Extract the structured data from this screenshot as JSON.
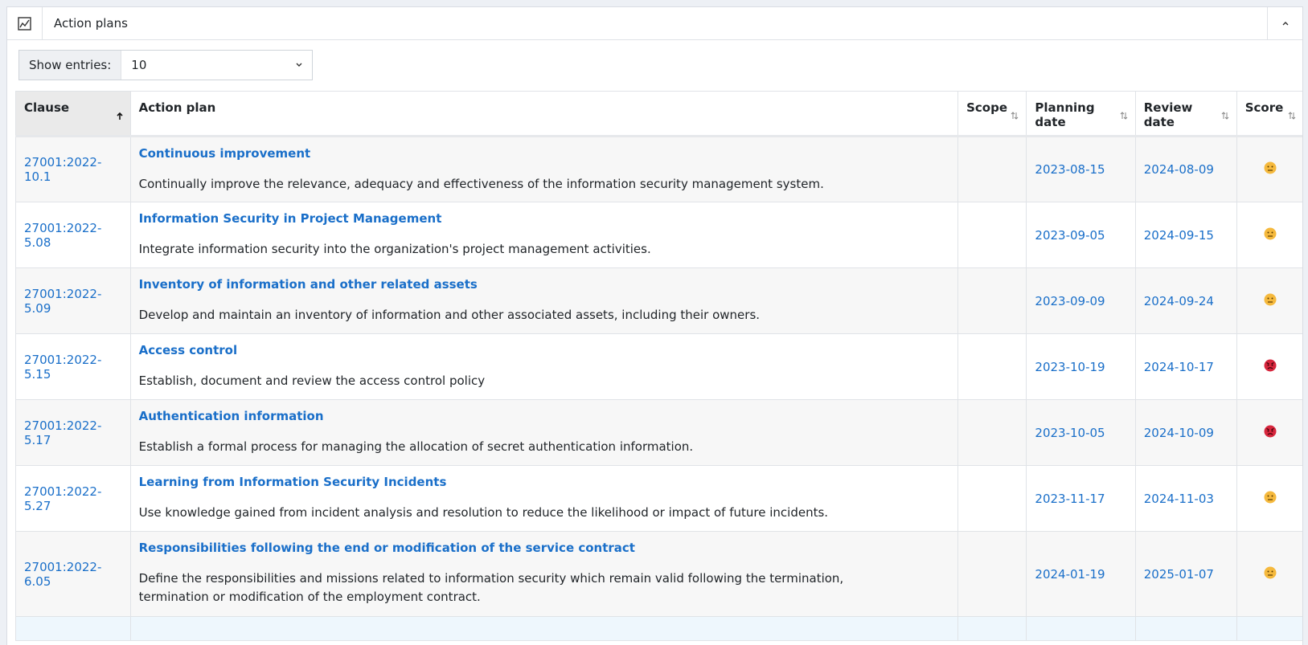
{
  "panel": {
    "title": "Action plans",
    "header_icon": "chart-line-icon",
    "collapse_icon": "chevron-up-icon"
  },
  "entries": {
    "label": "Show entries:",
    "value": "10"
  },
  "table": {
    "columns": [
      {
        "label": "Clause",
        "sort": "ascending"
      },
      {
        "label": "Action plan",
        "sort": "none"
      },
      {
        "label": "Scope",
        "sort": "sortable"
      },
      {
        "label": "Planning date",
        "sort": "sortable"
      },
      {
        "label": "Review date",
        "sort": "sortable"
      },
      {
        "label": "Score",
        "sort": "sortable"
      }
    ],
    "rows": [
      {
        "clause": "27001:2022-10.1",
        "title": "Continuous improvement",
        "desc": "Continually improve the relevance, adequacy and effectiveness of the information security management system.",
        "scope": "",
        "planning": "2023-08-15",
        "review": "2024-08-09",
        "score": "neutral"
      },
      {
        "clause": "27001:2022-5.08",
        "title": "Information Security in Project Management",
        "desc": "Integrate information security into the organization's project management activities.",
        "scope": "",
        "planning": "2023-09-05",
        "review": "2024-09-15",
        "score": "neutral"
      },
      {
        "clause": "27001:2022-5.09",
        "title": "Inventory of information and other related assets",
        "desc": "Develop and maintain an inventory of information and other associated assets, including their owners.",
        "scope": "",
        "planning": "2023-09-09",
        "review": "2024-09-24",
        "score": "neutral"
      },
      {
        "clause": "27001:2022-5.15",
        "title": "Access control",
        "desc": "Establish, document and review the access control policy",
        "scope": "",
        "planning": "2023-10-19",
        "review": "2024-10-17",
        "score": "angry"
      },
      {
        "clause": "27001:2022-5.17",
        "title": "Authentication information",
        "desc": "Establish a formal process for managing the allocation of secret authentication information.",
        "scope": "",
        "planning": "2023-10-05",
        "review": "2024-10-09",
        "score": "angry"
      },
      {
        "clause": "27001:2022-5.27",
        "title": "Learning from Information Security Incidents",
        "desc": "Use knowledge gained from incident analysis and resolution to reduce the likelihood or impact of future incidents.",
        "scope": "",
        "planning": "2023-11-17",
        "review": "2024-11-03",
        "score": "neutral"
      },
      {
        "clause": "27001:2022-6.05",
        "title": "Responsibilities following the end or modification of the service contract",
        "desc": "Define the responsibilities and missions related to information security which remain valid following the termination, termination or modification of the employment contract.",
        "scope": "",
        "planning": "2024-01-19",
        "review": "2025-01-07",
        "score": "neutral"
      }
    ]
  },
  "colors": {
    "link": "#1a6fc9",
    "neutral_face": "#f5b93d",
    "angry_face": "#d7263d"
  }
}
